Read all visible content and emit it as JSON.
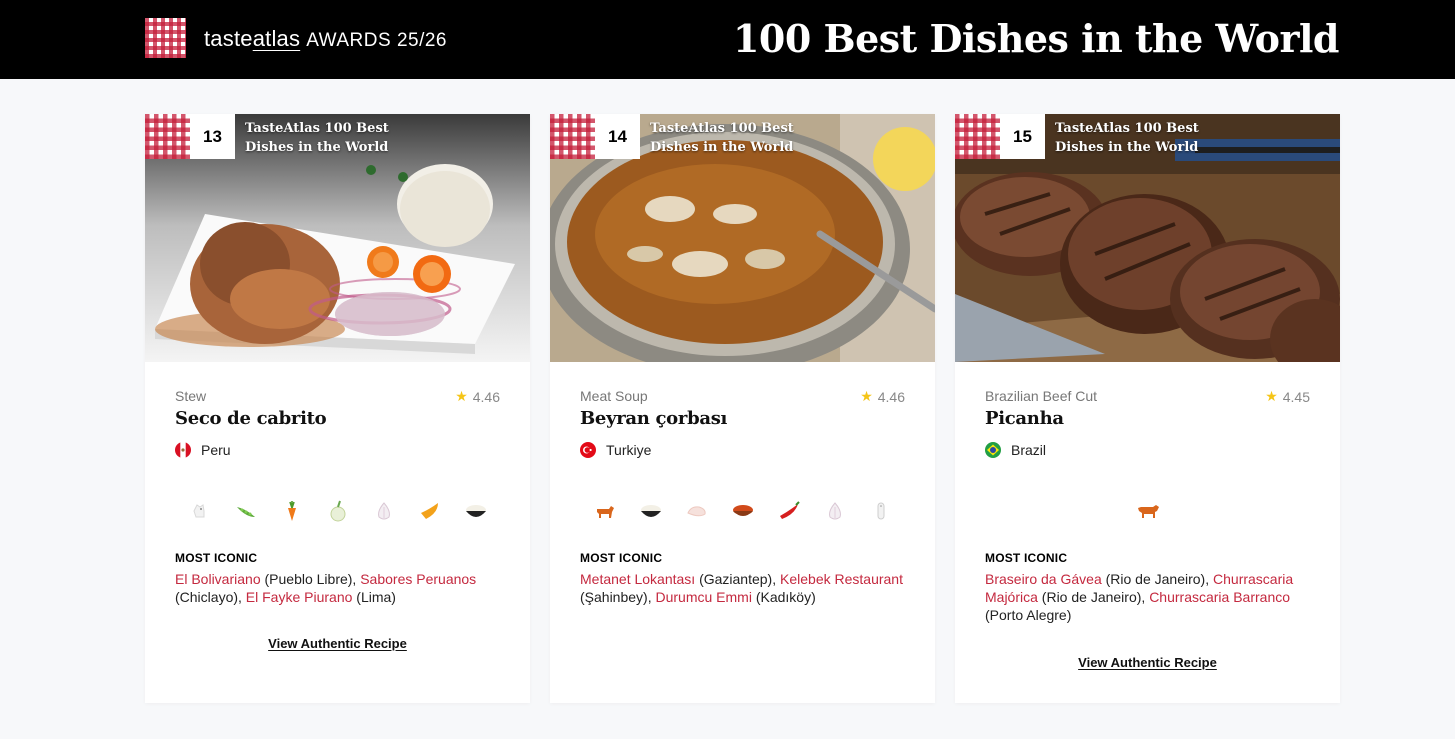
{
  "header": {
    "brand_taste": "taste",
    "brand_atlas": "atlas",
    "brand_awards": "AWARDS 25/26",
    "title": "100 Best Dishes in the World"
  },
  "colors": {
    "accent": "#c4293f",
    "star": "#f5c518",
    "header_bg": "#000000"
  },
  "cards": [
    {
      "rank": "13",
      "award_label": "TasteAtlas 100 Best Dishes in the World",
      "category": "Stew",
      "rating": "4.46",
      "name": "Seco de cabrito",
      "country": "Peru",
      "flag_icon": "peru-flag-icon",
      "ingredient_icons": [
        "goat-icon",
        "peas-icon",
        "carrot-icon",
        "onion-icon",
        "garlic-icon",
        "chili-pepper-icon",
        "rice-bowl-icon"
      ],
      "most_iconic_label": "MOST ICONIC",
      "iconic": [
        {
          "name": "El Bolivariano",
          "place": " (Pueblo Libre), "
        },
        {
          "name": "Sabores Peruanos",
          "place": " (Chiclayo), "
        },
        {
          "name": "El Fayke Piurano",
          "place": " (Lima)"
        }
      ],
      "recipe_label": "View Authentic Recipe"
    },
    {
      "rank": "14",
      "award_label": "TasteAtlas 100 Best Dishes in the World",
      "category": "Meat Soup",
      "rating": "4.46",
      "name": "Beyran çorbası",
      "country": "Turkiye",
      "flag_icon": "turkey-flag-icon",
      "ingredient_icons": [
        "lamb-icon",
        "rice-bowl-icon",
        "meat-icon",
        "paprika-icon",
        "red-chili-icon",
        "garlic-icon",
        "salt-icon"
      ],
      "most_iconic_label": "MOST ICONIC",
      "iconic": [
        {
          "name": "Metanet Lokantası",
          "place": " (Gaziantep), "
        },
        {
          "name": "Kelebek Restaurant",
          "place": " (Şahinbey), "
        },
        {
          "name": "Durumcu Emmi",
          "place": " (Kadıköy)"
        }
      ],
      "recipe_label": ""
    },
    {
      "rank": "15",
      "award_label": "TasteAtlas 100 Best Dishes in the World",
      "category": "Brazilian Beef Cut",
      "rating": "4.45",
      "name": "Picanha",
      "country": "Brazil",
      "flag_icon": "brazil-flag-icon",
      "ingredient_icons": [
        "beef-icon"
      ],
      "most_iconic_label": "MOST ICONIC",
      "iconic": [
        {
          "name": "Braseiro da Gávea",
          "place": " (Rio de Janeiro), "
        },
        {
          "name": "Churrascaria Majórica",
          "place": " (Rio de Janeiro), "
        },
        {
          "name": "Churrascaria Barranco",
          "place": " (Porto Alegre)"
        }
      ],
      "recipe_label": "View Authentic Recipe"
    }
  ]
}
